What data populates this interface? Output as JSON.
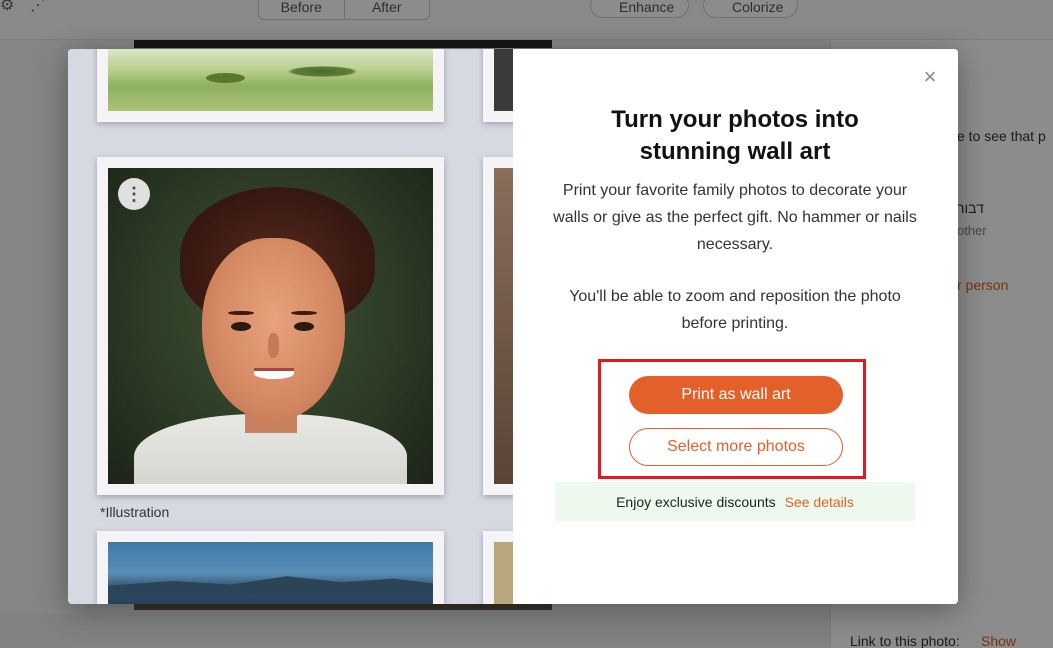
{
  "background_app": {
    "toolbar": {
      "segmented": [
        "Before",
        "After"
      ],
      "pills": [
        "Enhance",
        "Colorize"
      ]
    },
    "right_panel": {
      "text1": "e to see that p",
      "hebrew_name": "דבור",
      "relation": "other",
      "link_text": "r person",
      "link_to_photo_label": "Link to this photo:",
      "show_link": "Show"
    }
  },
  "modal": {
    "gallery": {
      "caption": "*Illustration",
      "menu_icon": "kebab-menu-icon"
    },
    "close_icon": "×",
    "title": "Turn your photos into stunning wall art",
    "description": "Print your favorite family photos to decorate your walls or give as the perfect gift. No hammer or nails necessary.",
    "description2": "You'll be able to zoom and reposition the photo before printing.",
    "primary_button": "Print as wall art",
    "secondary_button": "Select more photos",
    "promo": {
      "text": "Enjoy exclusive discounts",
      "link": "See details"
    },
    "colors": {
      "accent": "#e4602a",
      "highlight_border": "#e11a22",
      "promo_bg": "#eef9ee"
    }
  }
}
